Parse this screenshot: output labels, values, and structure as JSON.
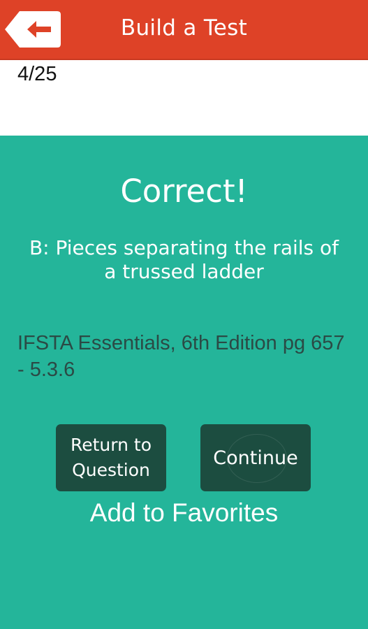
{
  "header": {
    "title": "Build a Test",
    "back_icon": "arrow-left-icon",
    "color": "#de4227"
  },
  "progress": {
    "text": "4/25"
  },
  "result": {
    "heading": "Correct!",
    "answer": "B: Pieces separating the rails of a trussed ladder",
    "reference": "IFSTA Essentials, 6th Edition pg 657 - 5.3.6"
  },
  "buttons": {
    "return_label": "Return to Question",
    "continue_label": "Continue",
    "color": "#1c4d40"
  },
  "favorites": {
    "label": "Add to Favorites"
  },
  "colors": {
    "background": "#24b59a",
    "reference_text": "#2b4a45"
  }
}
